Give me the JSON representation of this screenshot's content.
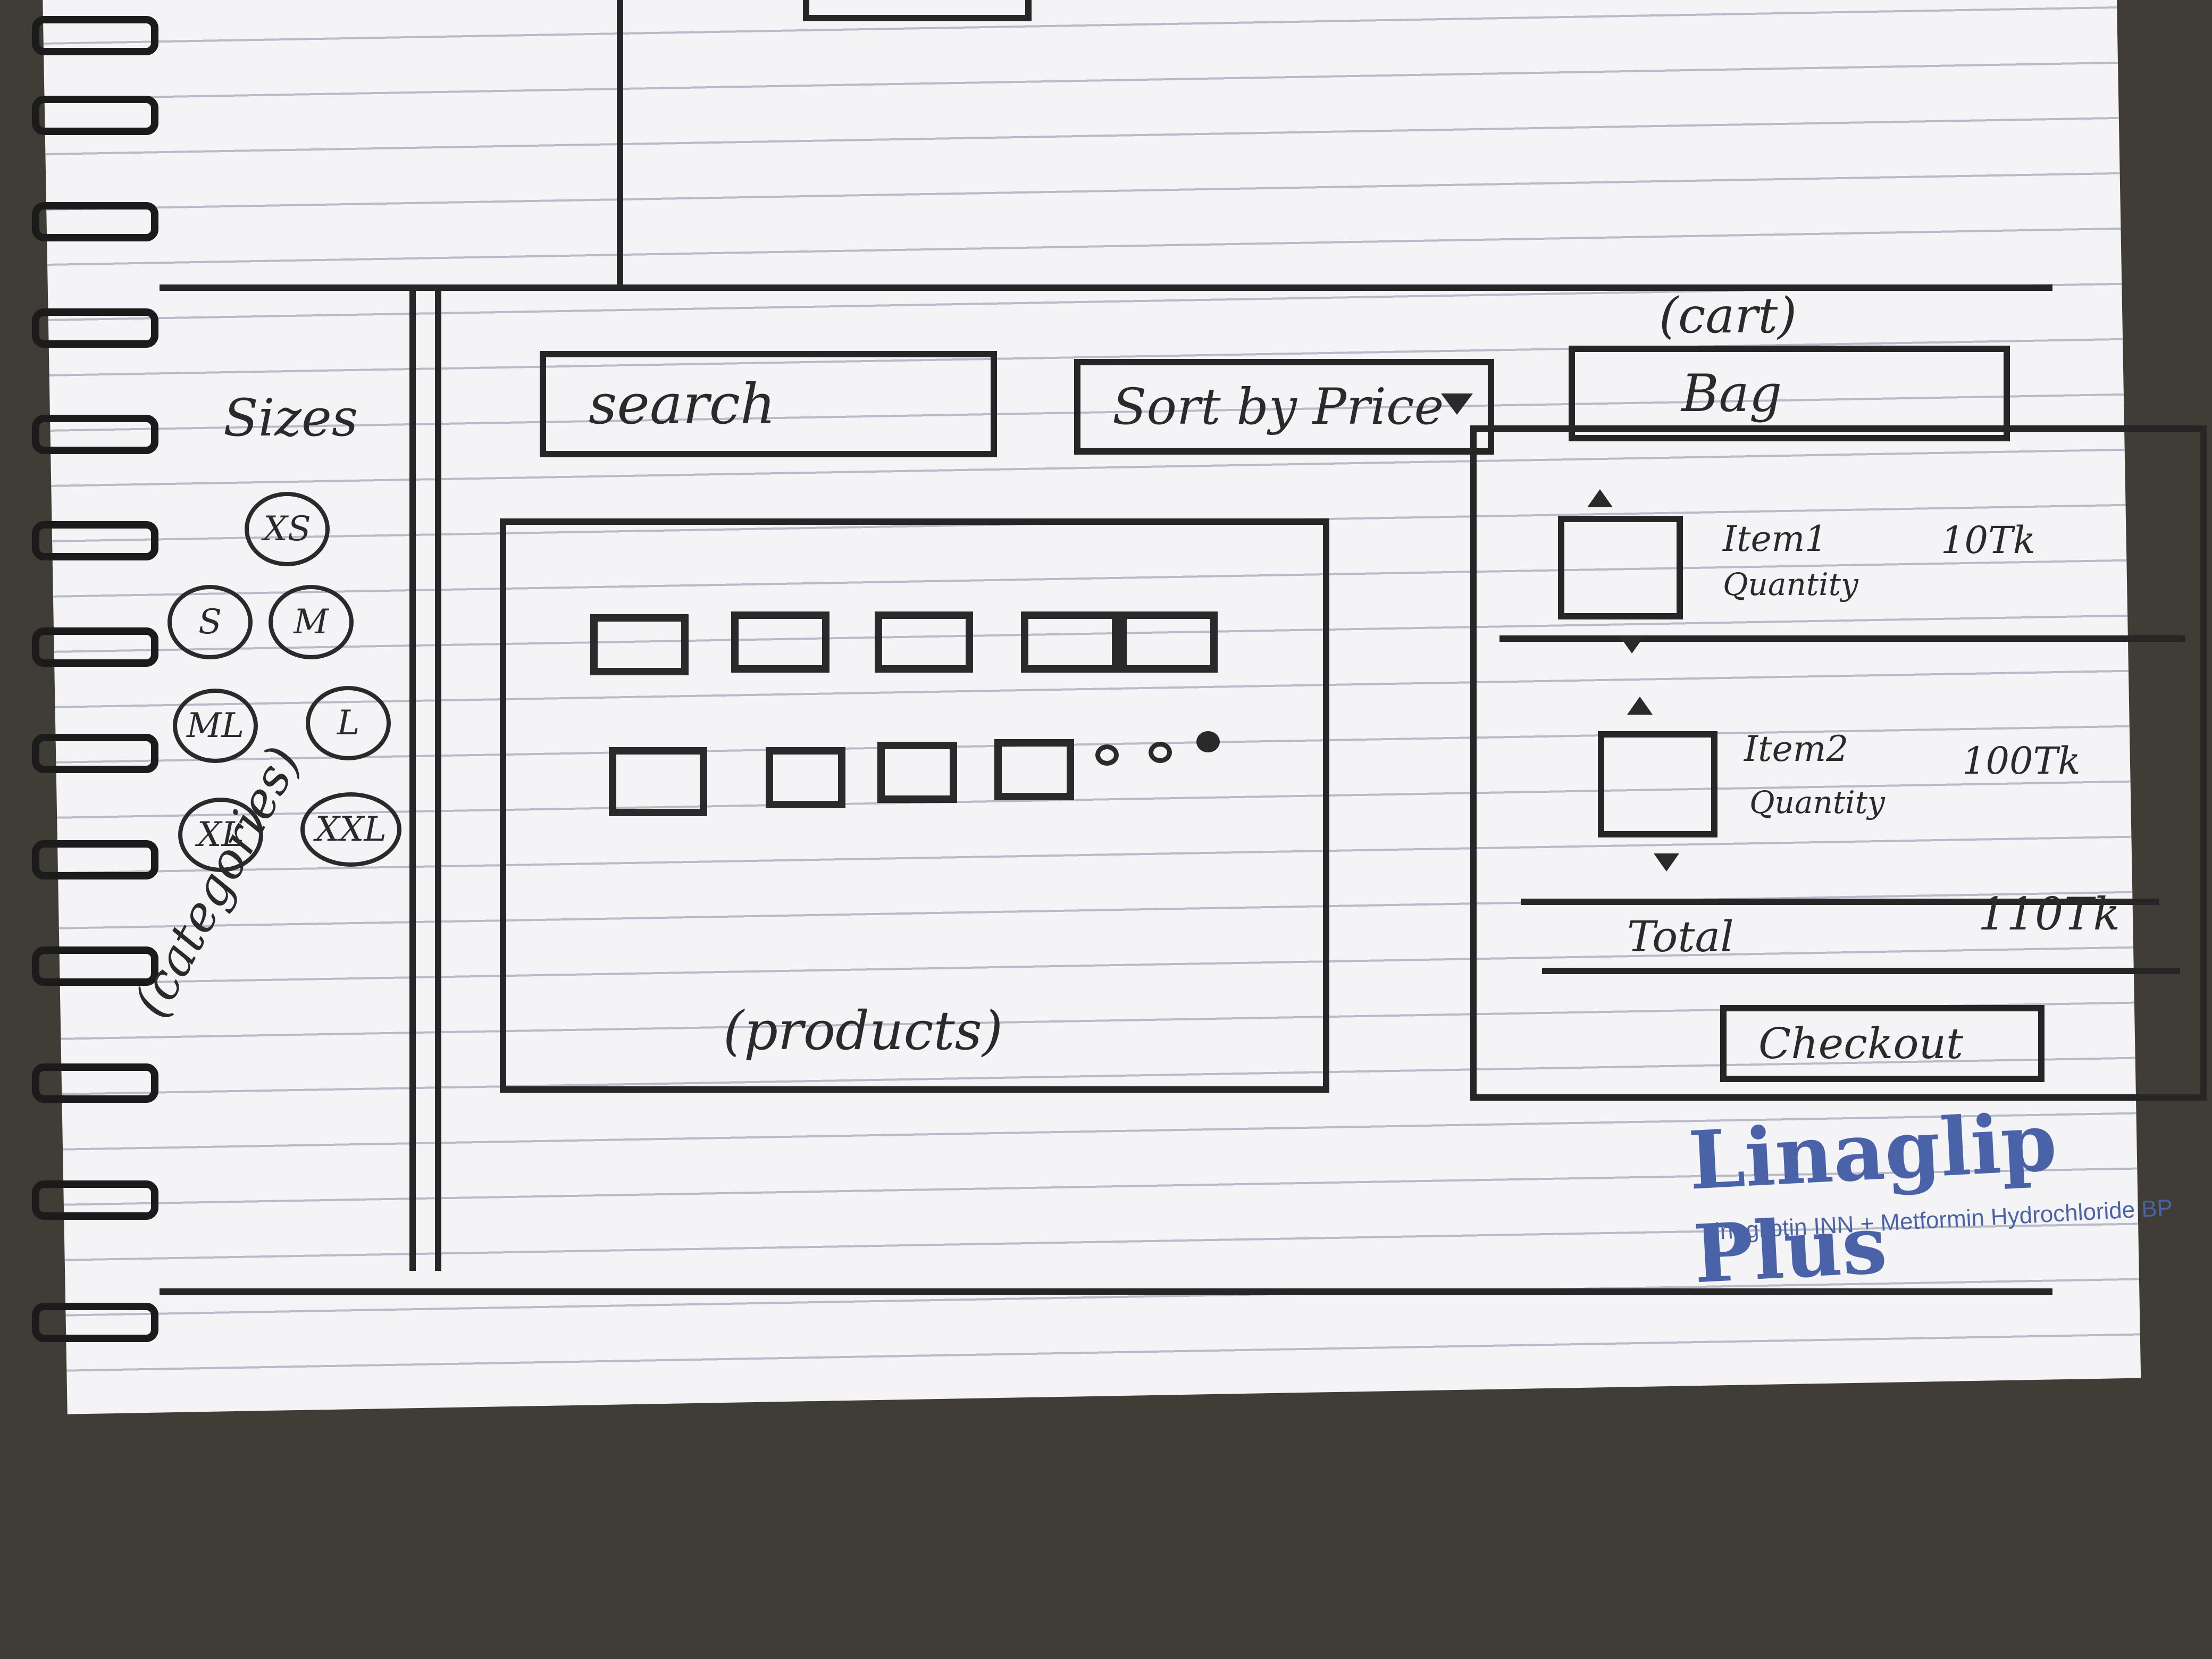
{
  "sidebar": {
    "sizes_heading": "Sizes",
    "sizes": [
      "XS",
      "S",
      "M",
      "ML",
      "L",
      "XL",
      "XXL"
    ],
    "categories_label": "(categories)"
  },
  "toolbar": {
    "search_label": "search",
    "sort_label": "Sort by Price",
    "cart_note": "(cart)",
    "bag_label": "Bag"
  },
  "products": {
    "caption": "(products)",
    "row1_count": 5,
    "row2_count": 4
  },
  "cart": {
    "items": [
      {
        "name": "Item1",
        "qty_label": "Quantity",
        "price": "10Tk"
      },
      {
        "name": "Item2",
        "qty_label": "Quantity",
        "price": "100Tk"
      }
    ],
    "total_label": "Total",
    "total_value": "110Tk",
    "checkout_label": "Checkout"
  },
  "watermark": {
    "brand": "Linaglip Plus",
    "sub": "Linagliptin INN + Metformin Hydrochloride BP"
  }
}
